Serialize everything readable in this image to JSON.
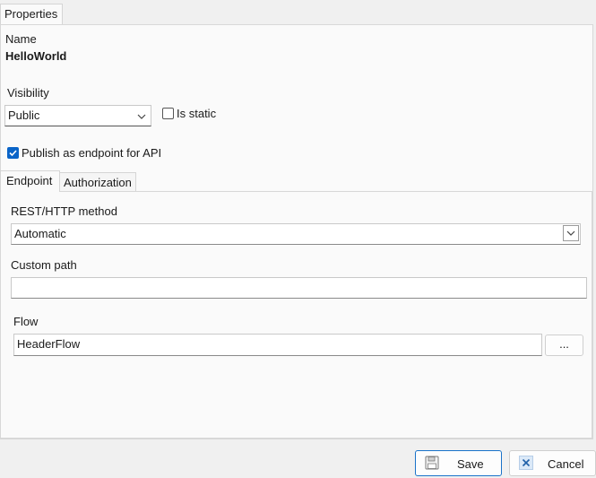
{
  "window": {
    "tab_label": "Properties"
  },
  "name_section": {
    "label": "Name",
    "value": "HelloWorld"
  },
  "visibility": {
    "label": "Visibility",
    "selected": "Public"
  },
  "is_static": {
    "label": "Is static",
    "checked": false
  },
  "publish": {
    "label": "Publish as endpoint for API",
    "checked": true
  },
  "inner_tabs": [
    {
      "label": "Endpoint",
      "active": true
    },
    {
      "label": "Authorization",
      "active": false
    }
  ],
  "endpoint": {
    "method_label": "REST/HTTP method",
    "method_value": "Automatic",
    "custom_path_label": "Custom path",
    "custom_path_value": "",
    "flow_label": "Flow",
    "flow_value": "HeaderFlow",
    "browse_label": "..."
  },
  "footer": {
    "save_label": "Save",
    "cancel_label": "Cancel"
  },
  "colors": {
    "accent": "#0a64c8",
    "primary_border": "#1a73c9"
  }
}
